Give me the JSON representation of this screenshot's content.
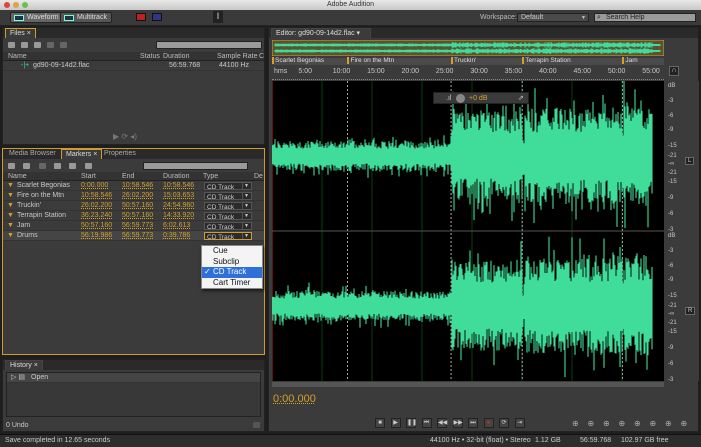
{
  "window": {
    "title": "Adobe Audition"
  },
  "toolbar": {
    "waveform_label": "Waveform",
    "multitrack_label": "Multitrack",
    "workspace_label": "Workspace:",
    "workspace_value": "Default",
    "search_help_placeholder": "Search Help"
  },
  "files": {
    "tab": "Files",
    "columns": [
      "Name",
      "Status",
      "Duration",
      "Sample Rate",
      "C"
    ],
    "rows": [
      {
        "name": "gd90-09-14d2.flac",
        "status": "",
        "duration": "56:59.768",
        "sample_rate": "44100 Hz"
      }
    ]
  },
  "markers": {
    "tabs": [
      "Media Browser",
      "Markers",
      "Properties"
    ],
    "active_tab": "Markers",
    "columns": [
      "Name",
      "Start",
      "End",
      "Duration",
      "Type",
      "De"
    ],
    "rows": [
      {
        "name": "Scarlet Begonias",
        "start": "0:00.000",
        "end": "10:58.546",
        "duration": "10:58.546",
        "type": "CD Track"
      },
      {
        "name": "Fire on the Mtn",
        "start": "10:58.546",
        "end": "26:02.200",
        "duration": "15:03.653",
        "type": "CD Track"
      },
      {
        "name": "Truckin'",
        "start": "26:02.200",
        "end": "50:57.160",
        "duration": "24:54.960",
        "type": "CD Track"
      },
      {
        "name": "Terrapin Station",
        "start": "36:23.240",
        "end": "50:57.160",
        "duration": "14:33.920",
        "type": "CD Track"
      },
      {
        "name": "Jam",
        "start": "50:57.160",
        "end": "56:59.773",
        "duration": "6:02.613",
        "type": "CD Track"
      },
      {
        "name": "Drums",
        "start": "56:19.986",
        "end": "56:59.773",
        "duration": "0:39.786",
        "type": "CD Track"
      }
    ],
    "type_options": [
      "Cue",
      "Subclip",
      "CD Track",
      "Cart Timer"
    ],
    "selected_type": "CD Track"
  },
  "history": {
    "tab": "History",
    "items": [
      "Open"
    ],
    "undo_count": "0 Undo"
  },
  "editor": {
    "tab": "Editor: gd90-09-14d2.flac",
    "marker_labels": [
      "Scarlet Begonias",
      "Fire on the Mtn",
      "Truckin'",
      "Terrapin Station",
      "Jam"
    ],
    "ruler": [
      "hms",
      "5:00",
      "10:00",
      "15:00",
      "20:00",
      "25:00",
      "30:00",
      "35:00",
      "40:00",
      "45:00",
      "50:00",
      "55:00"
    ],
    "hud_gain": "+0 dB",
    "db_scale": [
      "dB",
      "-3",
      "-6",
      "-9",
      "-15",
      "-21",
      "-∞",
      "-21",
      "-15",
      "-9",
      "-6",
      "-3"
    ],
    "channels": [
      "L",
      "R"
    ],
    "time": "0:00.000",
    "waveform_color": "#3fdc9a"
  },
  "status": {
    "message": "Save completed in 12.65 seconds",
    "format": "44100 Hz • 32-bit (float) • Stereo",
    "size": "1.12 GB",
    "duration": "56:59.768",
    "free": "102.97 GB free"
  }
}
